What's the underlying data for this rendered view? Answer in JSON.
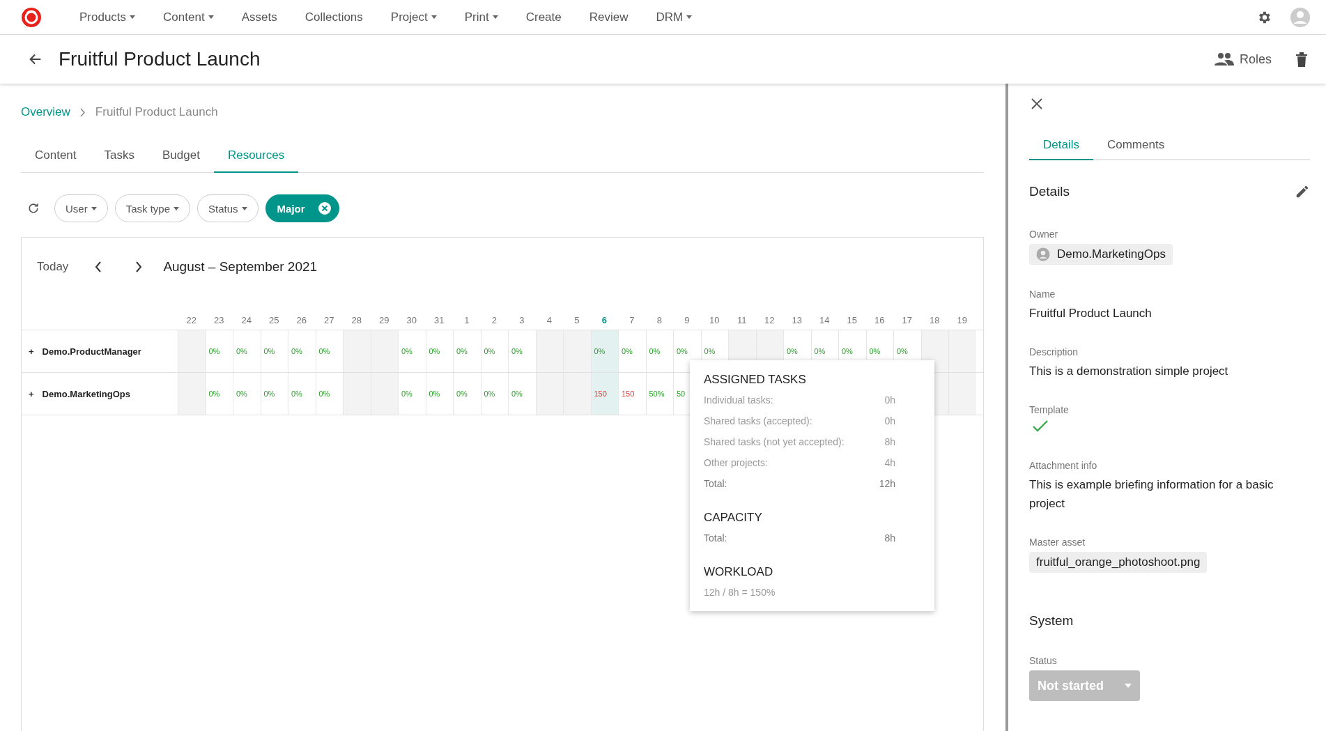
{
  "nav": {
    "items": [
      {
        "label": "Products",
        "dropdown": true
      },
      {
        "label": "Content",
        "dropdown": true
      },
      {
        "label": "Assets",
        "dropdown": false
      },
      {
        "label": "Collections",
        "dropdown": false
      },
      {
        "label": "Project",
        "dropdown": true
      },
      {
        "label": "Print",
        "dropdown": true
      },
      {
        "label": "Create",
        "dropdown": false
      },
      {
        "label": "Review",
        "dropdown": false
      },
      {
        "label": "DRM",
        "dropdown": true
      }
    ]
  },
  "header": {
    "title": "Fruitful Product Launch",
    "roles": "Roles"
  },
  "breadcrumb": [
    {
      "label": "Overview",
      "link": true
    },
    {
      "label": "Fruitful Product Launch",
      "link": false
    }
  ],
  "tabs": [
    {
      "label": "Content",
      "selected": false
    },
    {
      "label": "Tasks",
      "selected": false
    },
    {
      "label": "Budget",
      "selected": false
    },
    {
      "label": "Resources",
      "selected": true
    }
  ],
  "filters": [
    {
      "kind": "dropdown",
      "label": "User"
    },
    {
      "kind": "dropdown",
      "label": "Task type"
    },
    {
      "kind": "dropdown",
      "label": "Status"
    },
    {
      "kind": "active",
      "label": "Major"
    }
  ],
  "calendar": {
    "today_label": "Today",
    "range": "August – September 2021",
    "days": [
      {
        "label": "22",
        "weekend": true,
        "today": false
      },
      {
        "label": "23",
        "weekend": false,
        "today": false
      },
      {
        "label": "24",
        "weekend": false,
        "today": false
      },
      {
        "label": "25",
        "weekend": false,
        "today": false
      },
      {
        "label": "26",
        "weekend": false,
        "today": false
      },
      {
        "label": "27",
        "weekend": false,
        "today": false
      },
      {
        "label": "28",
        "weekend": true,
        "today": false
      },
      {
        "label": "29",
        "weekend": true,
        "today": false
      },
      {
        "label": "30",
        "weekend": false,
        "today": false
      },
      {
        "label": "31",
        "weekend": false,
        "today": false
      },
      {
        "label": "1",
        "weekend": false,
        "today": false
      },
      {
        "label": "2",
        "weekend": false,
        "today": false
      },
      {
        "label": "3",
        "weekend": false,
        "today": false
      },
      {
        "label": "4",
        "weekend": true,
        "today": false
      },
      {
        "label": "5",
        "weekend": true,
        "today": false
      },
      {
        "label": "6",
        "weekend": false,
        "today": true
      },
      {
        "label": "7",
        "weekend": false,
        "today": false
      },
      {
        "label": "8",
        "weekend": false,
        "today": false
      },
      {
        "label": "9",
        "weekend": false,
        "today": false
      },
      {
        "label": "10",
        "weekend": false,
        "today": false
      },
      {
        "label": "11",
        "weekend": true,
        "today": false
      },
      {
        "label": "12",
        "weekend": true,
        "today": false
      },
      {
        "label": "13",
        "weekend": false,
        "today": false
      },
      {
        "label": "14",
        "weekend": false,
        "today": false
      },
      {
        "label": "15",
        "weekend": false,
        "today": false
      },
      {
        "label": "16",
        "weekend": false,
        "today": false
      },
      {
        "label": "17",
        "weekend": false,
        "today": false
      },
      {
        "label": "18",
        "weekend": true,
        "today": false
      },
      {
        "label": "19",
        "weekend": true,
        "today": false
      }
    ],
    "rows": [
      {
        "expand": "+",
        "name": "Demo.ProductManager",
        "cells": [
          null,
          {
            "text": "0%",
            "over": false
          },
          {
            "text": "0%",
            "over": false
          },
          {
            "text": "0%",
            "over": false
          },
          {
            "text": "0%",
            "over": false
          },
          {
            "text": "0%",
            "over": false
          },
          null,
          null,
          {
            "text": "0%",
            "over": false
          },
          {
            "text": "0%",
            "over": false
          },
          {
            "text": "0%",
            "over": false
          },
          {
            "text": "0%",
            "over": false
          },
          {
            "text": "0%",
            "over": false
          },
          null,
          null,
          {
            "text": "0%",
            "over": false
          },
          {
            "text": "0%",
            "over": false
          },
          {
            "text": "0%",
            "over": false
          },
          {
            "text": "0%",
            "over": false
          },
          {
            "text": "0%",
            "over": false
          },
          null,
          null,
          {
            "text": "0%",
            "over": false
          },
          {
            "text": "0%",
            "over": false
          },
          {
            "text": "0%",
            "over": false
          },
          {
            "text": "0%",
            "over": false
          },
          {
            "text": "0%",
            "over": false
          },
          null,
          null
        ]
      },
      {
        "expand": "+",
        "name": "Demo.MarketingOps",
        "cells": [
          null,
          {
            "text": "0%",
            "over": false
          },
          {
            "text": "0%",
            "over": false
          },
          {
            "text": "0%",
            "over": false
          },
          {
            "text": "0%",
            "over": false
          },
          {
            "text": "0%",
            "over": false
          },
          null,
          null,
          {
            "text": "0%",
            "over": false
          },
          {
            "text": "0%",
            "over": false
          },
          {
            "text": "0%",
            "over": false
          },
          {
            "text": "0%",
            "over": false
          },
          {
            "text": "0%",
            "over": false
          },
          null,
          null,
          {
            "text": "150",
            "over": true
          },
          {
            "text": "150",
            "over": true
          },
          {
            "text": "50%",
            "over": false
          },
          {
            "text": "50",
            "over": false
          },
          null,
          null,
          null,
          null,
          null,
          null,
          null,
          null,
          null,
          null
        ]
      }
    ],
    "tooltip": {
      "sections": [
        {
          "title": "ASSIGNED TASKS",
          "lines": [
            {
              "label": "Individual tasks:",
              "value": "0h",
              "total": false
            },
            {
              "label": "Shared tasks (accepted):",
              "value": "0h",
              "total": false
            },
            {
              "label": "Shared tasks (not yet accepted):",
              "value": "8h",
              "total": false
            },
            {
              "label": "Other projects:",
              "value": "4h",
              "total": false
            },
            {
              "label": "Total:",
              "value": "12h",
              "total": true
            }
          ]
        },
        {
          "title": "CAPACITY",
          "lines": [
            {
              "label": "Total:",
              "value": "8h",
              "total": true
            }
          ]
        },
        {
          "title": "WORKLOAD",
          "lines": [
            {
              "label": "12h / 8h = 150%",
              "total": false
            }
          ]
        }
      ]
    }
  },
  "panel": {
    "tabs": [
      {
        "label": "Details",
        "selected": true
      },
      {
        "label": "Comments",
        "selected": false
      }
    ],
    "heading": "Details",
    "fields": [
      {
        "kind": "user",
        "label": "Owner",
        "value": "Demo.MarketingOps"
      },
      {
        "kind": "text",
        "label": "Name",
        "value": "Fruitful Product Launch"
      },
      {
        "kind": "text",
        "label": "Description",
        "value": "This is a demonstration simple project"
      },
      {
        "kind": "check",
        "label": "Template",
        "checked": true
      },
      {
        "kind": "text",
        "label": "Attachment info",
        "value": "This is example briefing information for a basic project"
      },
      {
        "kind": "chip",
        "label": "Master asset",
        "value": "fruitful_orange_photoshoot.png"
      }
    ],
    "system_heading": "System",
    "system_fields": [
      {
        "kind": "status",
        "label": "Status",
        "value": "Not started",
        "disabled": true
      }
    ]
  }
}
